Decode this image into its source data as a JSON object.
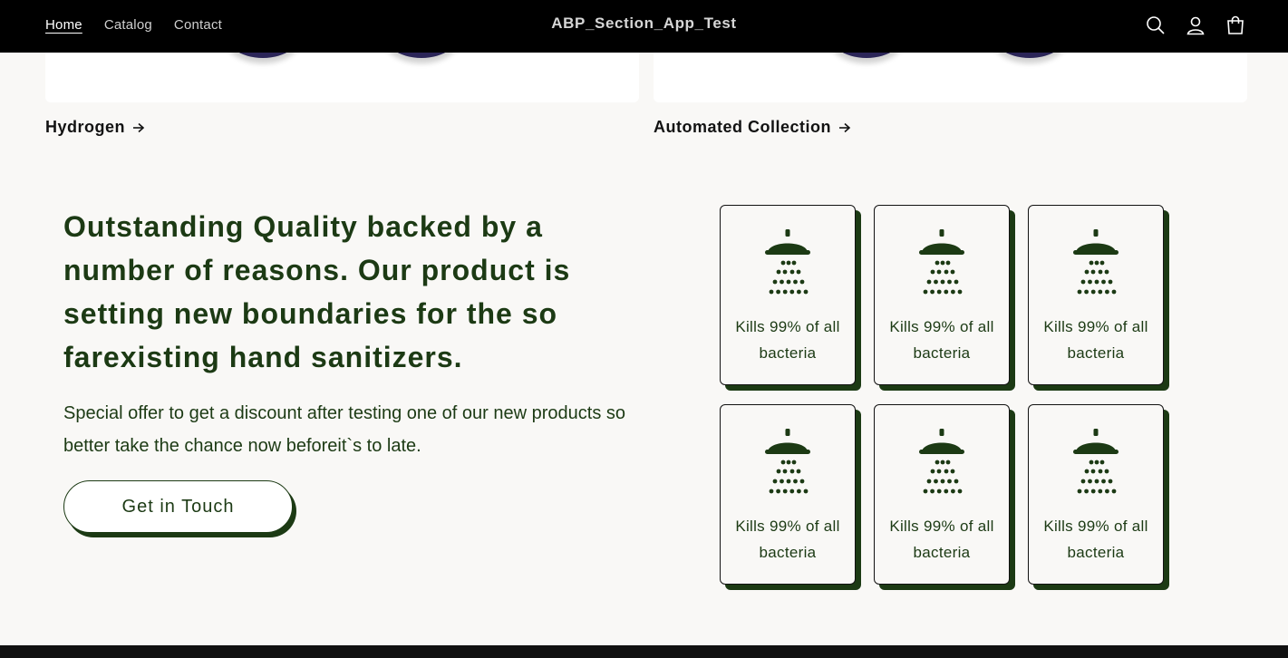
{
  "header": {
    "nav": [
      {
        "label": "Home",
        "active": true
      },
      {
        "label": "Catalog",
        "active": false
      },
      {
        "label": "Contact",
        "active": false
      }
    ],
    "site_title": "ABP_Section_App_Test",
    "icons": [
      "search-icon",
      "account-icon",
      "cart-icon"
    ]
  },
  "collections": [
    {
      "title": "Hydrogen"
    },
    {
      "title": "Automated Collection"
    }
  ],
  "promo": {
    "heading": "Outstanding Quality backed by a number of reasons. Our product is setting new boundaries for the so farexisting hand sanitizers.",
    "text": "Special offer to get a discount after testing one of our new products so better take the chance now beforeit`s to late.",
    "cta_label": "Get in Touch"
  },
  "features": [
    {
      "label": "Kills 99% of all bacteria",
      "icon": "shower-icon"
    },
    {
      "label": "Kills 99% of all bacteria",
      "icon": "shower-icon"
    },
    {
      "label": "Kills 99% of all bacteria",
      "icon": "shower-icon"
    },
    {
      "label": "Kills 99% of all bacteria",
      "icon": "shower-icon"
    },
    {
      "label": "Kills 99% of all bacteria",
      "icon": "shower-icon"
    },
    {
      "label": "Kills 99% of all bacteria",
      "icon": "shower-icon"
    }
  ],
  "colors": {
    "header_bg": "#000000",
    "accent": "#1c3a14",
    "page_bg": "#f9f8f6"
  }
}
